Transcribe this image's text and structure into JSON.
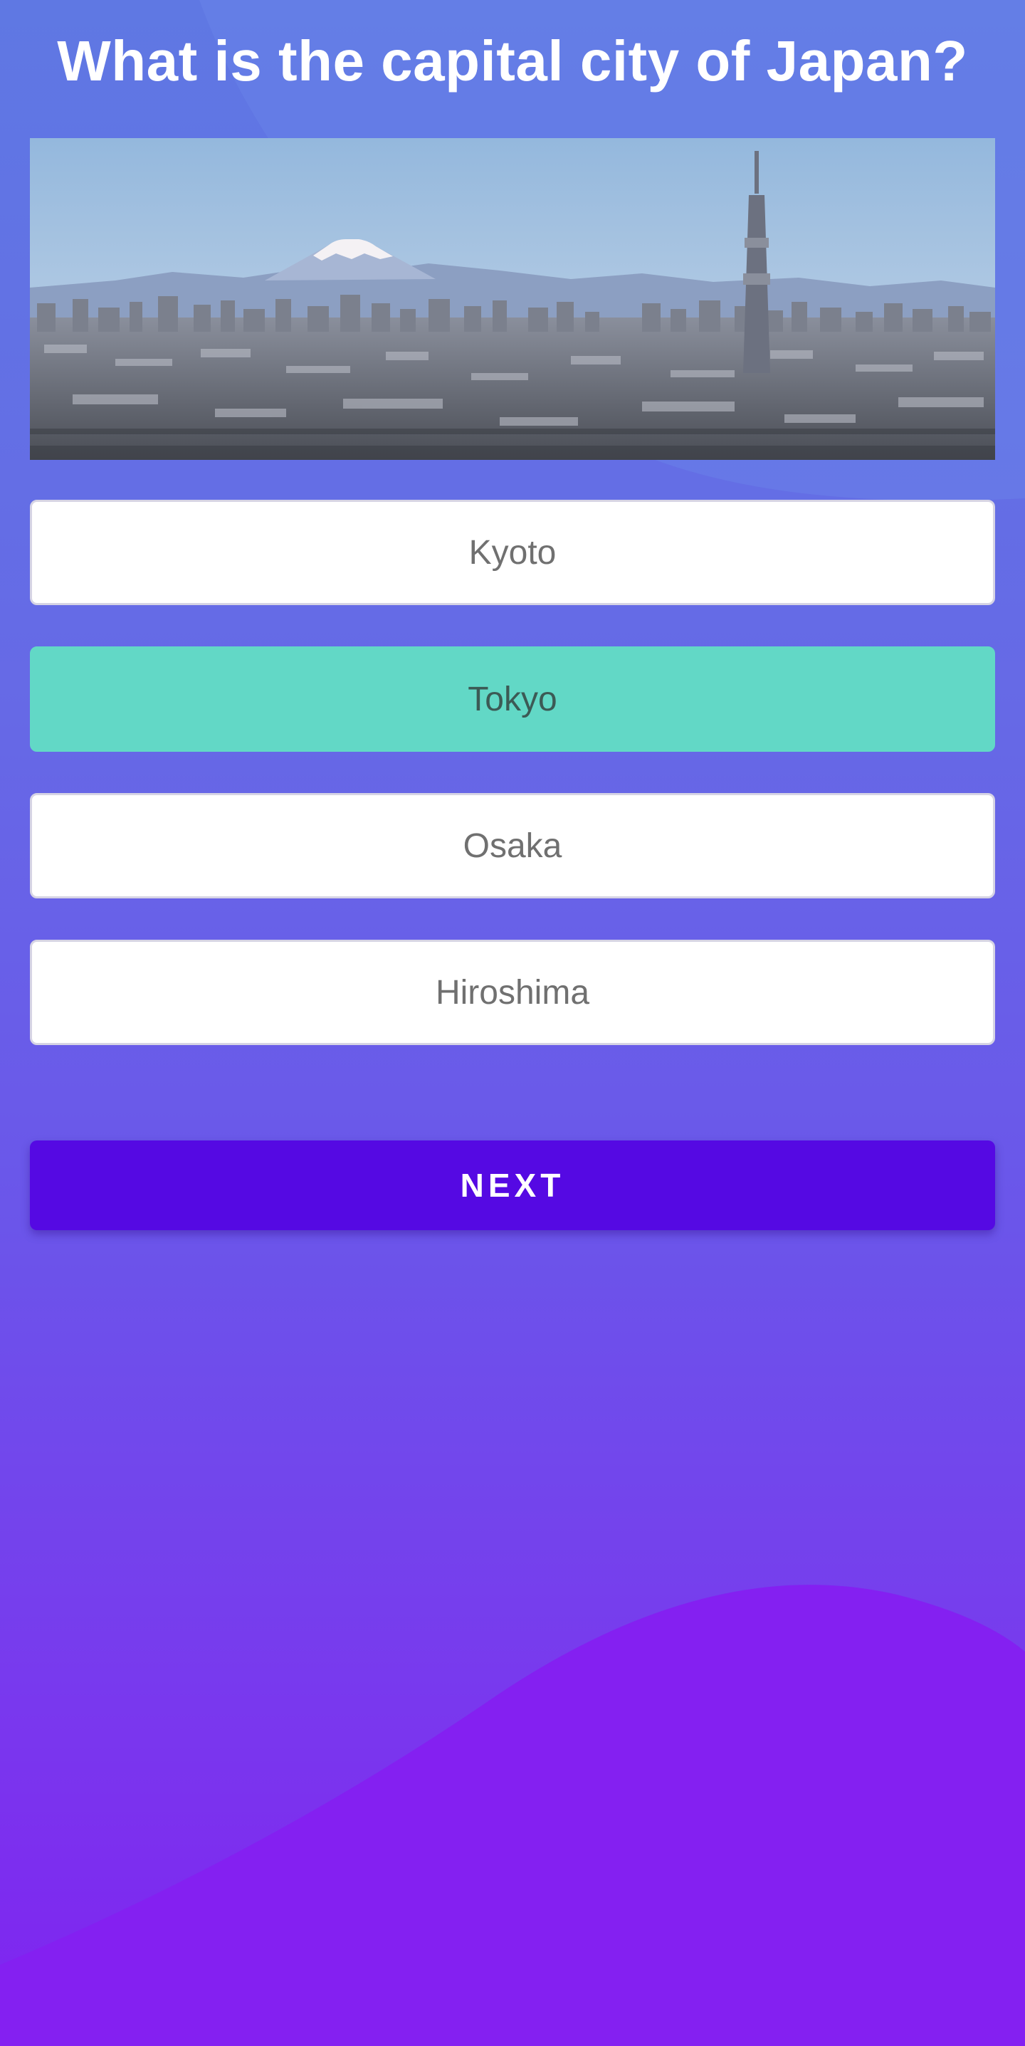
{
  "quiz": {
    "question": "What is the capital city of Japan?",
    "image_alt": "Tokyo skyline with Mount Fuji and Tokyo Skytree",
    "options": [
      {
        "label": "Kyoto",
        "selected": false
      },
      {
        "label": "Tokyo",
        "selected": true
      },
      {
        "label": "Osaka",
        "selected": false
      },
      {
        "label": "Hiroshima",
        "selected": false
      }
    ],
    "next_label": "NEXT"
  },
  "colors": {
    "background_top": "#5f78e3",
    "background_bottom": "#7f23f0",
    "selected_option": "#62d8c6",
    "next_button": "#5509e3",
    "option_text": "#707070"
  }
}
